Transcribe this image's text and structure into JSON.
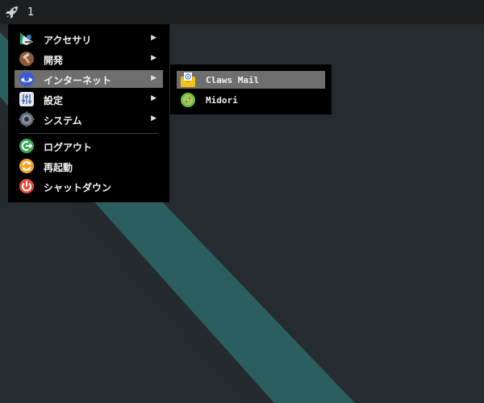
{
  "panel": {
    "launcher_icon": "rocket-icon",
    "workspace": "1"
  },
  "menu": {
    "items": [
      {
        "label": "アクセサリ",
        "icon": "accessories-icon",
        "has_submenu": true
      },
      {
        "label": "開発",
        "icon": "development-icon",
        "has_submenu": true
      },
      {
        "label": "インターネット",
        "icon": "internet-icon",
        "has_submenu": true,
        "active": true
      },
      {
        "label": "設定",
        "icon": "settings-icon",
        "has_submenu": true
      },
      {
        "label": "システム",
        "icon": "system-icon",
        "has_submenu": true
      }
    ],
    "actions": [
      {
        "label": "ログアウト",
        "icon": "logout-icon"
      },
      {
        "label": "再起動",
        "icon": "restart-icon"
      },
      {
        "label": "シャットダウン",
        "icon": "shutdown-icon"
      }
    ],
    "arrow": "▶"
  },
  "submenu": {
    "items": [
      {
        "label": "Claws Mail",
        "icon": "mail-icon",
        "active": true
      },
      {
        "label": "Midori",
        "icon": "browser-icon"
      }
    ]
  },
  "colors": {
    "desktop_bg": "#262b30",
    "stripe": "#2b5f5f",
    "panel_bg": "#1c1f22",
    "menu_bg": "#000000",
    "highlight": "#6e6e6e"
  }
}
